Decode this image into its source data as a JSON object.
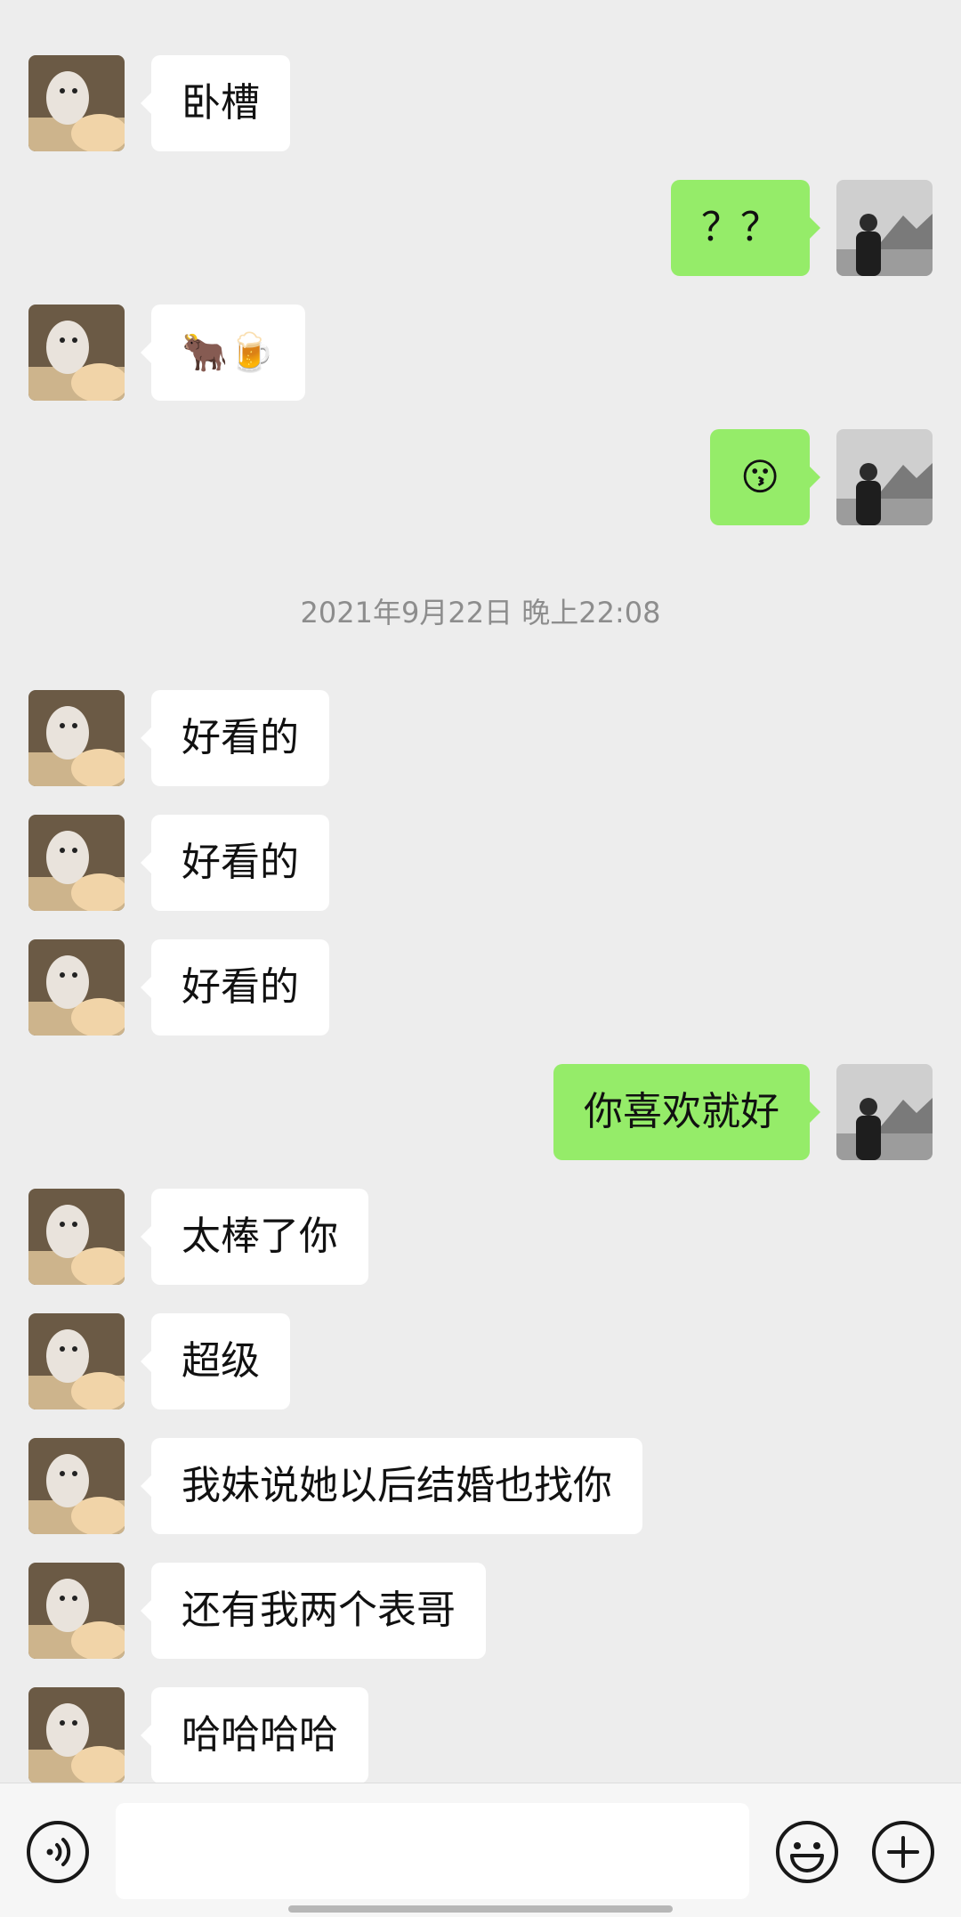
{
  "messages": [
    {
      "side": "in",
      "text": "卧槽"
    },
    {
      "side": "out",
      "text": "？？"
    },
    {
      "side": "in",
      "text": "🐂🍺"
    },
    {
      "side": "out",
      "text": "😗"
    },
    {
      "side": "in",
      "text": "好看的"
    },
    {
      "side": "in",
      "text": "好看的"
    },
    {
      "side": "in",
      "text": "好看的"
    },
    {
      "side": "out",
      "text": "你喜欢就好"
    },
    {
      "side": "in",
      "text": "太棒了你"
    },
    {
      "side": "in",
      "text": "超级"
    },
    {
      "side": "in",
      "text": "我妹说她以后结婚也找你"
    },
    {
      "side": "in",
      "text": "还有我两个表哥"
    },
    {
      "side": "in",
      "text": "哈哈哈哈"
    }
  ],
  "timestamp": "2021年9月22日 晚上22:08",
  "input": {
    "value": "",
    "placeholder": ""
  },
  "colors": {
    "background": "#ededed",
    "incoming_bubble": "#ffffff",
    "outgoing_bubble": "#95ec69"
  },
  "icons": {
    "voice": "voice-icon",
    "emoji": "emoji-icon",
    "plus": "plus-icon"
  }
}
